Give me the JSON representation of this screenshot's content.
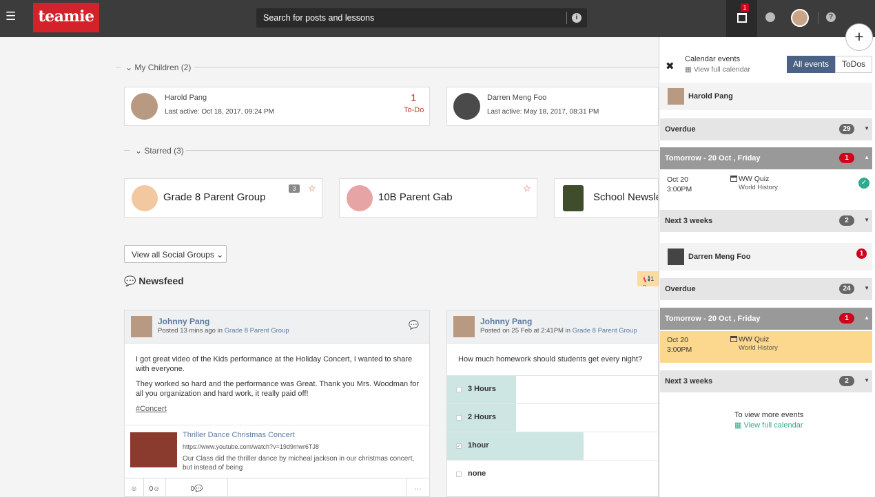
{
  "topbar": {
    "logo_text": "teamie",
    "search_placeholder": "Search for posts and lessons",
    "info_icon": "i",
    "calendar_badge": "1",
    "help_icon": "?"
  },
  "children_section": {
    "heading": "My Children (2)",
    "children": [
      {
        "name": "Harold Pang",
        "last_active": "Last active: Oct 18, 2017, 09:24 PM",
        "todo_count": "1",
        "todo_label": "To-Do"
      },
      {
        "name": "Darren Meng Foo",
        "last_active": "Last active: May 18, 2017, 08:31 PM"
      }
    ]
  },
  "starred_section": {
    "heading": "Starred (3)",
    "groups": [
      {
        "name": "Grade 8 Parent Group",
        "badge": "3"
      },
      {
        "name": "10B Parent Gab"
      },
      {
        "name": "School Newsle"
      }
    ],
    "view_all": "View all Social Groups"
  },
  "newsfeed": {
    "title": "Newsfeed",
    "announcement": "1 n",
    "posts": [
      {
        "author": "Johnny Pang",
        "meta_prefix": "Posted 13 mins ago in ",
        "group": "Grade 8 Parent Group",
        "para1": "I got great video of the Kids performance at the Holiday Concert, I wanted to share with everyone.",
        "para2": "They worked so hard and the performance was Great. Thank you Mrs. Woodman for all you organization and hard work, it really paid off!",
        "tag": "#Concert",
        "link_title": "Thriller Dance Christmas Concert",
        "link_url": "https://www.youtube.com/watch?v=19d9mwr6TJ8",
        "link_desc": "Our Class did the thriller dance by micheal jackson in our christmas concert, but instead of being",
        "footer": {
          "like": "☺",
          "likes_count": "0☺",
          "comments_count": "0",
          "more": "···"
        }
      },
      {
        "author": "Johnny Pang",
        "meta_prefix": "Posted on 25 Feb at 2:41PM in ",
        "group": "Grade 8 Parent Group",
        "question": "How much homework should students get every night?",
        "options": [
          {
            "label": "3 Hours",
            "fill": 0.33,
            "checked": false
          },
          {
            "label": "2 Hours",
            "fill": 0.33,
            "checked": false
          },
          {
            "label": "1hour",
            "fill": 0.65,
            "checked": true
          },
          {
            "label": "none",
            "fill": 0,
            "checked": false
          }
        ]
      }
    ]
  },
  "calendar_panel": {
    "title": "Calendar events",
    "view_full": "View full calendar",
    "tab_all": "All events",
    "tab_todos": "ToDos",
    "kids": [
      {
        "name": "Harold Pang",
        "overdue_label": "Overdue",
        "overdue_count": "29",
        "tomorrow_label": "Tomorrow - 20 Oct , Friday",
        "tomorrow_count": "1",
        "event": {
          "date": "Oct 20",
          "time": "3:00PM",
          "title": "WW Quiz",
          "course": "World History"
        },
        "next_label": "Next 3 weeks",
        "next_count": "2"
      },
      {
        "name": "Darren Meng Foo",
        "badge": "1",
        "overdue_label": "Overdue",
        "overdue_count": "24",
        "tomorrow_label": "Tomorrow - 20 Oct , Friday",
        "tomorrow_count": "1",
        "event": {
          "date": "Oct 20",
          "time": "3:00PM",
          "title": "WW Quiz",
          "course": "World History"
        },
        "next_label": "Next 3 weeks",
        "next_count": "2"
      }
    ],
    "more_text": "To view more events",
    "more_link": "View full calendar"
  },
  "colors": {
    "accent": "#4c6285",
    "brand": "#d3222a",
    "success": "#2eab8f",
    "alert": "#d0021b"
  }
}
